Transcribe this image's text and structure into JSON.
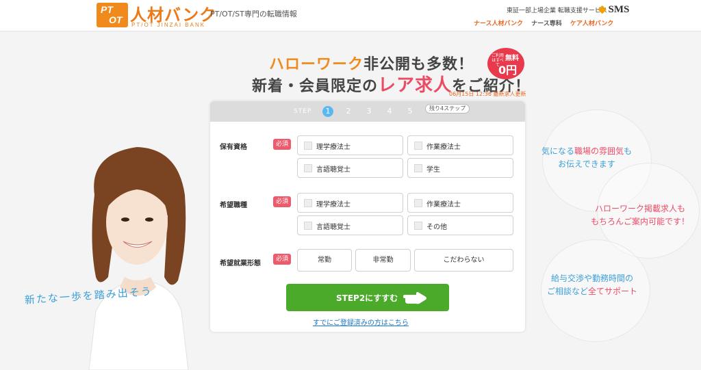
{
  "header": {
    "logo_badge_line1": "PT",
    "logo_badge_line2": "OT",
    "logo_text": "人材バンク",
    "logo_sub": "PT/OT JINZAI BANK",
    "tagline": "PT/OT/ST専門の転職情報",
    "corp_text": "東証一部上場企業 転職支援サービス",
    "sms_logo": "SMS",
    "partners": [
      "ナース人材バンク",
      "ナース専科",
      "ケア人材バンク"
    ]
  },
  "hero": {
    "line1_highlight": "ハローワーク",
    "line1_rest": "非公開も多数！",
    "line2_pre": "新着・会員限定の",
    "line2_highlight": "レア求人",
    "line2_post": "をご紹介！",
    "badge_small": "ご利用はすべて",
    "badge_label": "無料",
    "badge_value": "0円",
    "update_text": "06月15日 12:36 最新求人更新"
  },
  "form": {
    "step_label": "STEP",
    "steps": [
      "1",
      "2",
      "3",
      "4",
      "5"
    ],
    "current_step": 1,
    "remaining": "残り4ステップ",
    "required_label": "必須",
    "qualification": {
      "label": "保有資格",
      "options": [
        "理学療法士",
        "作業療法士",
        "言語聴覚士",
        "学生"
      ]
    },
    "desired_job": {
      "label": "希望職種",
      "options": [
        "理学療法士",
        "作業療法士",
        "言語聴覚士",
        "その他"
      ]
    },
    "employment_type": {
      "label": "希望就業形態",
      "options": [
        "常勤",
        "非常勤",
        "こだわらない"
      ]
    },
    "next_button": "STEP2にすすむ",
    "login_link": "すでにご登録済みの方はこちら"
  },
  "slogan": "新たな一歩を踏み出そう",
  "features": [
    {
      "line1_blue": "気になる",
      "line1_mid": "職場の雰囲気",
      "line1_end": "も",
      "line2": "お伝えできます"
    },
    {
      "line1": "ハローワーク掲載求人も",
      "line2": "もちろんご案内可能です！"
    },
    {
      "line1": "給与交渉や勤務時間の",
      "line2_pre": "ご相談など",
      "line2_highlight": "全てサポート"
    }
  ],
  "colors": {
    "brand_orange": "#f08a1c",
    "accent_pink": "#ec4b66",
    "button_green": "#4caa2a",
    "step_active_blue": "#5ab8f0",
    "link_blue": "#1a76c8"
  }
}
